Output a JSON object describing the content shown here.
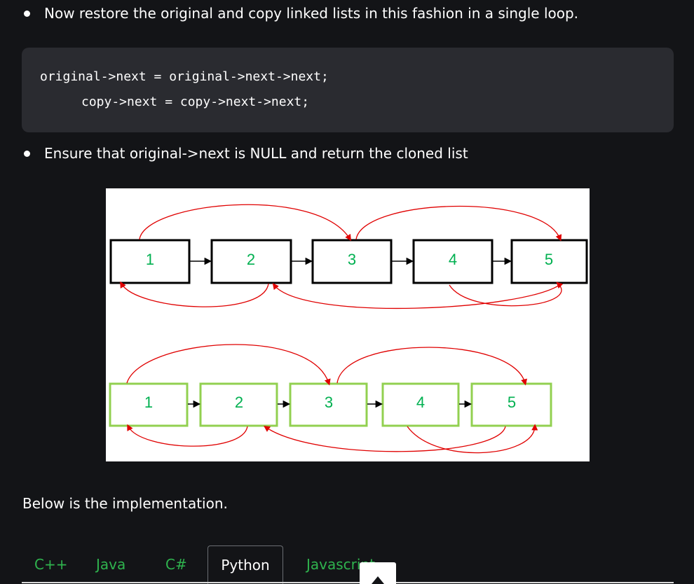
{
  "bullets": [
    "Now restore the original and copy linked lists in this fashion in a single loop.",
    "Ensure that original->next is NULL and return the cloned list"
  ],
  "code": {
    "lines": [
      "original->next = original->next->next;",
      "copy->next = copy->next->next;"
    ]
  },
  "figure": {
    "top_nodes": [
      "1",
      "2",
      "3",
      "4",
      "5"
    ],
    "bottom_nodes": [
      "1",
      "2",
      "3",
      "4",
      "5"
    ],
    "colors": {
      "top_border": "#000000",
      "bottom_border": "#92d050",
      "label": "#00b050",
      "arrow": "#e00000"
    }
  },
  "implementation_text": "Below is the implementation.",
  "tabs": {
    "items": [
      "C++",
      "Java",
      "C#",
      "Python",
      "Javascript"
    ],
    "active": "Python"
  },
  "colors": {
    "background": "#131417",
    "code_background": "#2a2b30",
    "tab_text": "#2fb34e"
  },
  "icons": {
    "scroll_top": "chevron-up-icon"
  }
}
